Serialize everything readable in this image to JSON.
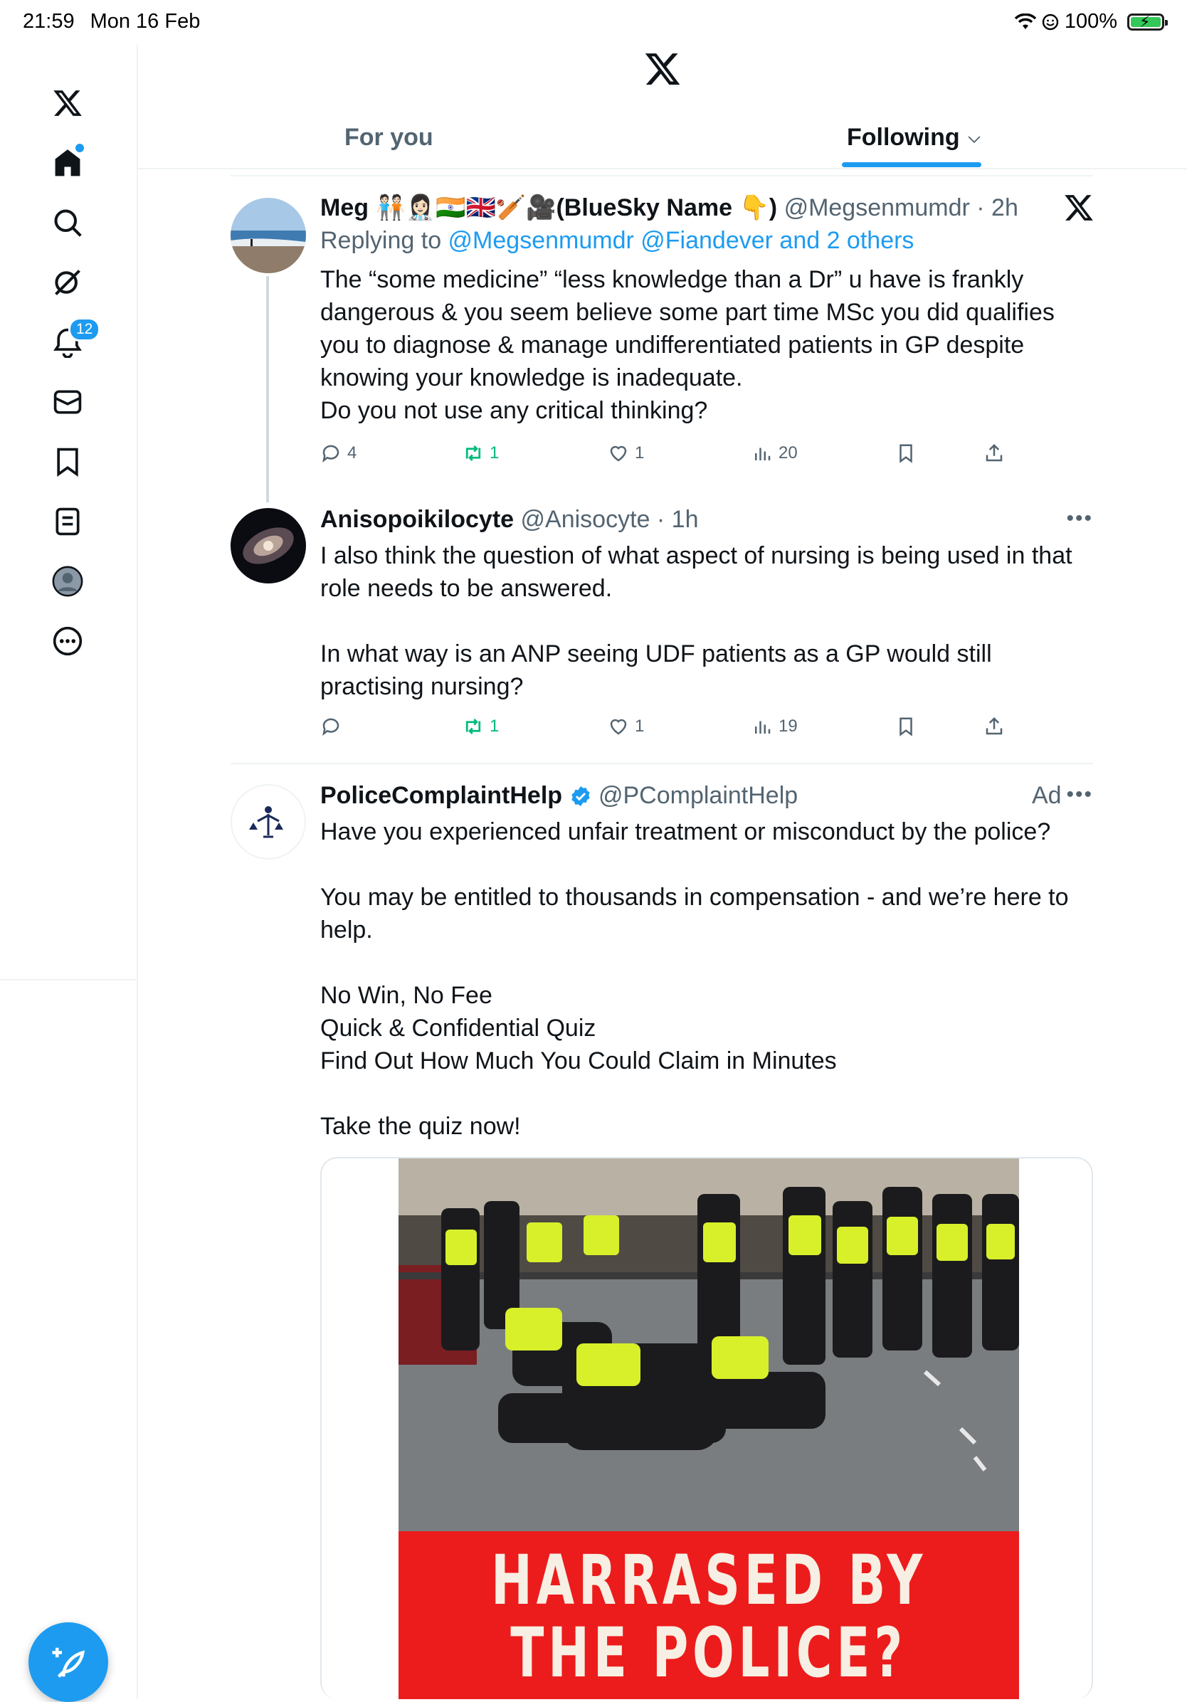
{
  "status_bar": {
    "time": "21:59",
    "date": "Mon 16 Feb",
    "battery": "100%"
  },
  "rail": {
    "notifications_count": "12",
    "items": [
      "home-icon",
      "search-icon",
      "grok-icon",
      "notifications-icon",
      "messages-icon",
      "bookmarks-icon",
      "lists-icon",
      "profile-icon",
      "more-icon"
    ]
  },
  "tabs": {
    "for_you": "For you",
    "following": "Following",
    "active": "Following"
  },
  "tweets": [
    {
      "name": "Meg 🧑🏻‍🤝‍🧑🏻👩🏻‍⚕️🇮🇳🇬🇧🏏🎥(BlueSky Name 👇)",
      "handle": "@Megsenmumdr",
      "time": "· 2h",
      "reply_prefix": "Replying to ",
      "reply_to": "@Megsenmumdr @Fiandever and 2 others",
      "text": "The “some medicine” “less knowledge than a Dr” u have is frankly\ndangerous & you seem believe some part time MSc you did qualifies\nyou to diagnose & manage undifferentiated patients in GP despite\nknowing your knowledge is inadequate.\nDo you not use any critical thinking?",
      "replies": "4",
      "retweets": "1",
      "likes": "1",
      "views": "20"
    },
    {
      "name": "Anisopoikilocyte",
      "handle": "@Anisocyte",
      "time": "· 1h",
      "text": "I also think the question of what aspect of nursing is being used in that\nrole needs to be answered.\n\nIn what way is an ANP seeing UDF patients as a GP would still\npractising nursing?",
      "replies": "",
      "retweets": "1",
      "likes": "1",
      "views": "19"
    },
    {
      "name": "PoliceComplaintHelp",
      "handle": "@PComplaintHelp",
      "ad_label": "Ad",
      "text": "Have you experienced unfair treatment or misconduct by the police?\n\nYou may be entitled to thousands in compensation - and we’re here to\nhelp.\n\nNo Win, No Fee\nQuick & Confidential Quiz\nFind Out How Much You Could Claim in Minutes\n\nTake the quiz now!",
      "media_text_line1": "HARRASED BY",
      "media_text_line2": "THE POLICE?"
    }
  ],
  "colors": {
    "accent": "#1d9bf0",
    "retweet": "#00ba7c",
    "banner": "#ec1c1c"
  }
}
